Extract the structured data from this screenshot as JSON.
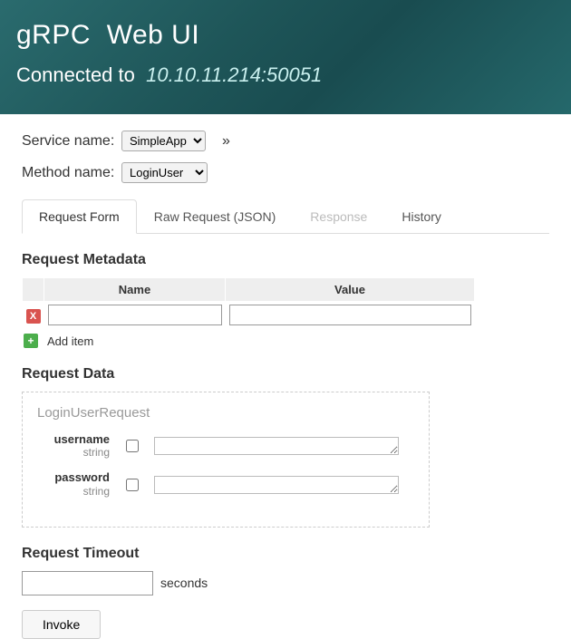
{
  "banner": {
    "brand": "gRPC",
    "app": "Web UI",
    "connected_label": "Connected to",
    "address": "10.10.11.214:50051"
  },
  "selectors": {
    "service_label": "Service name:",
    "service_value": "SimpleApp",
    "method_label": "Method name:",
    "method_value": "LoginUser",
    "expand_glyph": "»"
  },
  "tabs": [
    {
      "label": "Request Form",
      "active": true,
      "disabled": false
    },
    {
      "label": "Raw Request (JSON)",
      "active": false,
      "disabled": false
    },
    {
      "label": "Response",
      "active": false,
      "disabled": true
    },
    {
      "label": "History",
      "active": false,
      "disabled": false
    }
  ],
  "metadata": {
    "heading": "Request Metadata",
    "name_col": "Name",
    "value_col": "Value",
    "delete_glyph": "X",
    "add_glyph": "+",
    "add_label": "Add item",
    "row": {
      "name": "",
      "value": ""
    }
  },
  "request_data": {
    "heading": "Request Data",
    "message_type": "LoginUserRequest",
    "fields": [
      {
        "name": "username",
        "type": "string",
        "checked": false,
        "value": ""
      },
      {
        "name": "password",
        "type": "string",
        "checked": false,
        "value": ""
      }
    ]
  },
  "timeout": {
    "heading": "Request Timeout",
    "value": "",
    "unit": "seconds"
  },
  "invoke": {
    "label": "Invoke"
  }
}
